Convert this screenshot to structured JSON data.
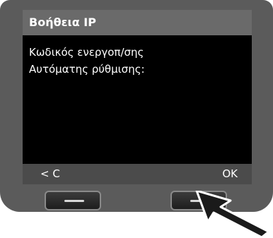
{
  "screen": {
    "title": "Βοήθεια IP",
    "lines": [
      "Κωδικός ενεργοπ/σης",
      "Αυτόματης ρύθμισης:"
    ],
    "softkeys": {
      "left_label": "< C",
      "right_label": "OK"
    }
  },
  "colors": {
    "device_body": "#5b5b5b",
    "screen_bg": "#000000",
    "title_bar": "#6a6a6a",
    "softkey_bar": "#4b4b4b",
    "text": "#ffffff"
  },
  "icons": {
    "hw_left": "minus-icon",
    "hw_right": "minus-icon",
    "pointer": "arrow-pointer-icon"
  }
}
